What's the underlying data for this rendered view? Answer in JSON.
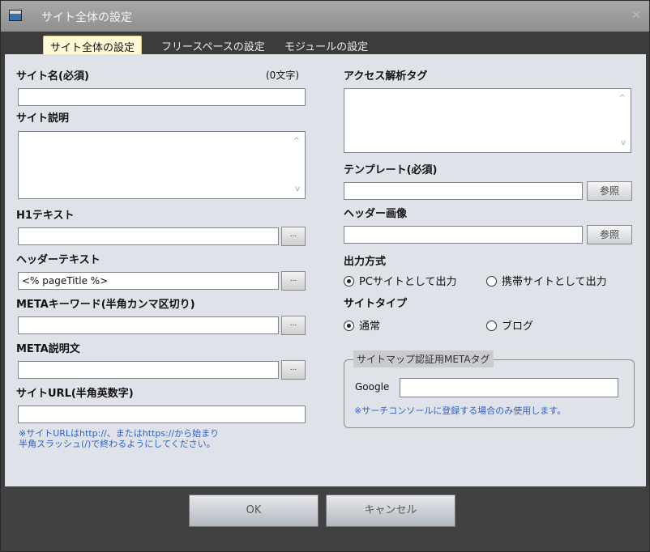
{
  "window": {
    "title": "サイト全体の設定",
    "close_glyph": "✕"
  },
  "tabs": [
    {
      "label": "サイト全体の設定",
      "active": true
    },
    {
      "label": "フリースペースの設定",
      "active": false
    },
    {
      "label": "モジュールの設定",
      "active": false
    }
  ],
  "left": {
    "site_name": {
      "label": "サイト名(必須)",
      "count": "(0文字)",
      "value": ""
    },
    "site_desc": {
      "label": "サイト説明",
      "value": ""
    },
    "h1_text": {
      "label": "H1テキスト",
      "value": "",
      "button": "..."
    },
    "header_text": {
      "label": "ヘッダーテキスト",
      "value": "<% pageTitle %>",
      "button": "..."
    },
    "meta_keywords": {
      "label": "METAキーワード(半角カンマ区切り)",
      "value": "",
      "button": "..."
    },
    "meta_desc": {
      "label": "META説明文",
      "value": "",
      "button": "..."
    },
    "site_url": {
      "label": "サイトURL(半角英数字)",
      "value": "",
      "note_line1": "※サイトURLはhttp://、またはhttps://から始まり",
      "note_line2": "半角スラッシュ(/)で終わるようにしてください。"
    }
  },
  "right": {
    "access_tag": {
      "label": "アクセス解析タグ",
      "value": ""
    },
    "template": {
      "label": "テンプレート(必須)",
      "value": "",
      "button": "参照"
    },
    "header_image": {
      "label": "ヘッダー画像",
      "value": "",
      "button": "参照"
    },
    "output_mode": {
      "label": "出力方式",
      "options": [
        {
          "label": "PCサイトとして出力",
          "selected": true
        },
        {
          "label": "携帯サイトとして出力",
          "selected": false
        }
      ]
    },
    "site_type": {
      "label": "サイトタイプ",
      "options": [
        {
          "label": "通常",
          "selected": true
        },
        {
          "label": "ブログ",
          "selected": false
        }
      ]
    },
    "sitemap_group": {
      "title": "サイトマップ認証用METAタグ",
      "google_label": "Google",
      "google_value": "",
      "note": "※サーチコンソールに登録する場合のみ使用します。"
    }
  },
  "footer": {
    "ok_label": "OK",
    "cancel_label": "キャンセル"
  },
  "icons": {
    "scroll_up": "^",
    "scroll_down": "v"
  },
  "colors": {
    "note_blue": "#2f62c9",
    "active_tab": "#fff9d6",
    "panel": "#dfe2e8"
  }
}
